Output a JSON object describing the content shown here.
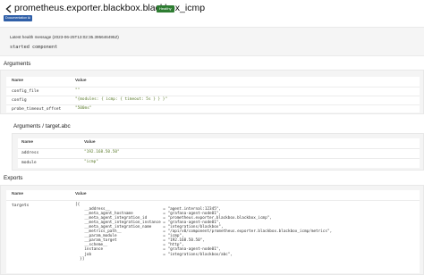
{
  "header": {
    "title": "prometheus.exporter.blackbox.blackbox_icmp",
    "health_badge": "Healthy",
    "doc_link": "Documentation ⧉"
  },
  "health": {
    "label": "Latest health message (2023-06-25T13:02:35.395646495Z)",
    "message": "started component"
  },
  "arguments": {
    "heading": "Arguments",
    "col_name": "Name",
    "col_value": "Value",
    "rows": [
      {
        "name": "config_file",
        "value": "\"\""
      },
      {
        "name": "config",
        "value": "\"{modules: { icmp: { timeout: 5s } } }\""
      },
      {
        "name": "probe_timeout_offset",
        "value": "\"500ms\""
      }
    ]
  },
  "target_args": {
    "heading": "Arguments / target.abc",
    "col_name": "Name",
    "col_value": "Value",
    "rows": [
      {
        "name": "address",
        "value": "\"192.168.50.50\""
      },
      {
        "name": "module",
        "value": "\"icmp\""
      }
    ]
  },
  "exports": {
    "heading": "Exports",
    "col_name": "Name",
    "col_value": "Value",
    "row_name": "targets",
    "row_value": "[{\n    __address__                       = \"agent.internal:12345\",\n    __meta_agent_hostname             = \"grafana-agent-node01\",\n    __meta_agent_integration_id       = \"prometheus.exporter.blackbox.blackbox_icmp\",\n    __meta_agent_integration_instance = \"grafana-agent-node01\",\n    __meta_agent_integration_name     = \"integrations/blackbox\",\n    __metrics_path__                  = \"/api/v0/component/prometheus.exporter.blackbox.blackbox_icmp/metrics\",\n    __param_module                    = \"icmp\",\n    __param_target                    = \"192.168.50.50\",\n    __scheme__                        = \"http\",\n    instance                          = \"grafana-agent-node01\",\n    job                               = \"integrations/blackbox/abc\",\n  }]"
  }
}
